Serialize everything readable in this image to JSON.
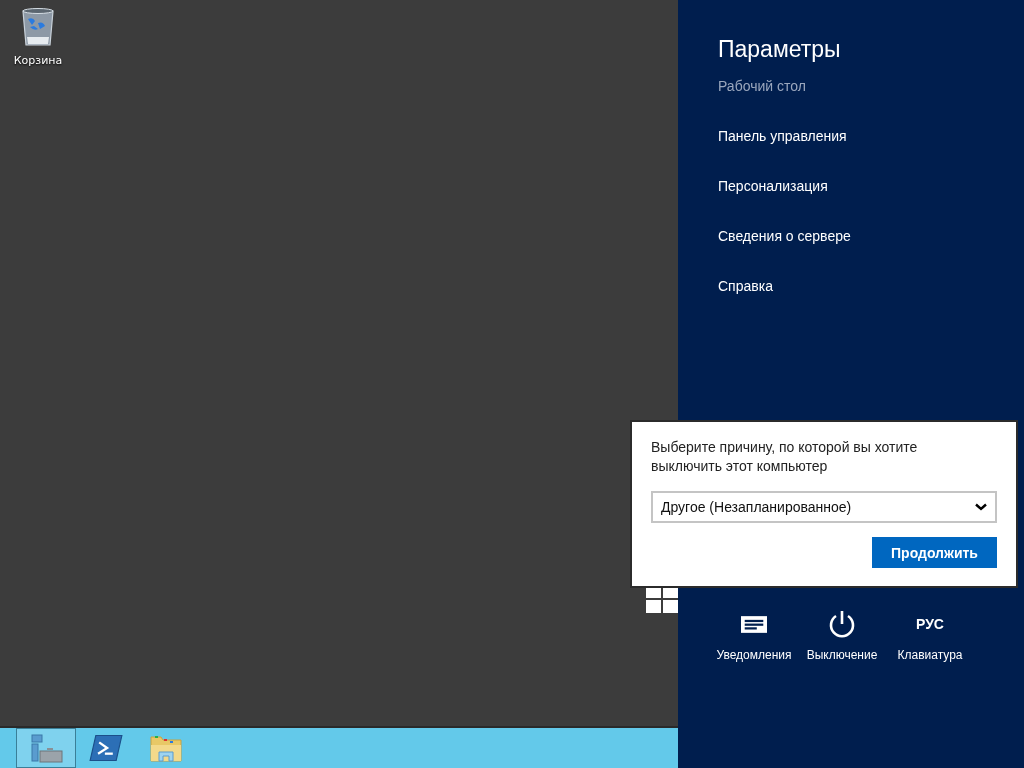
{
  "desktop": {
    "icons": [
      {
        "label": "Корзина"
      }
    ]
  },
  "taskbar": {
    "items": [
      {
        "kind": "server-manager",
        "selected": true
      },
      {
        "kind": "powershell",
        "selected": false
      },
      {
        "kind": "explorer",
        "selected": false
      }
    ]
  },
  "settings_pane": {
    "title": "Параметры",
    "items": [
      {
        "label": "Рабочий стол",
        "dimmed": true
      },
      {
        "label": "Панель управления",
        "dimmed": false
      },
      {
        "label": "Персонализация",
        "dimmed": false
      },
      {
        "label": "Сведения о сервере",
        "dimmed": false
      },
      {
        "label": "Справка",
        "dimmed": false
      }
    ],
    "quick_settings": [
      {
        "kind": "notifications",
        "label": "Уведомления"
      },
      {
        "kind": "power",
        "label": "Выключение"
      },
      {
        "kind": "keyboard",
        "glyph": "РУС",
        "label": "Клавиатура"
      }
    ]
  },
  "shutdown_dialog": {
    "prompt": "Выберите причину, по которой вы хотите выключить этот компьютер",
    "reason": "Другое (Незапланированное)",
    "button": "Продолжить"
  }
}
